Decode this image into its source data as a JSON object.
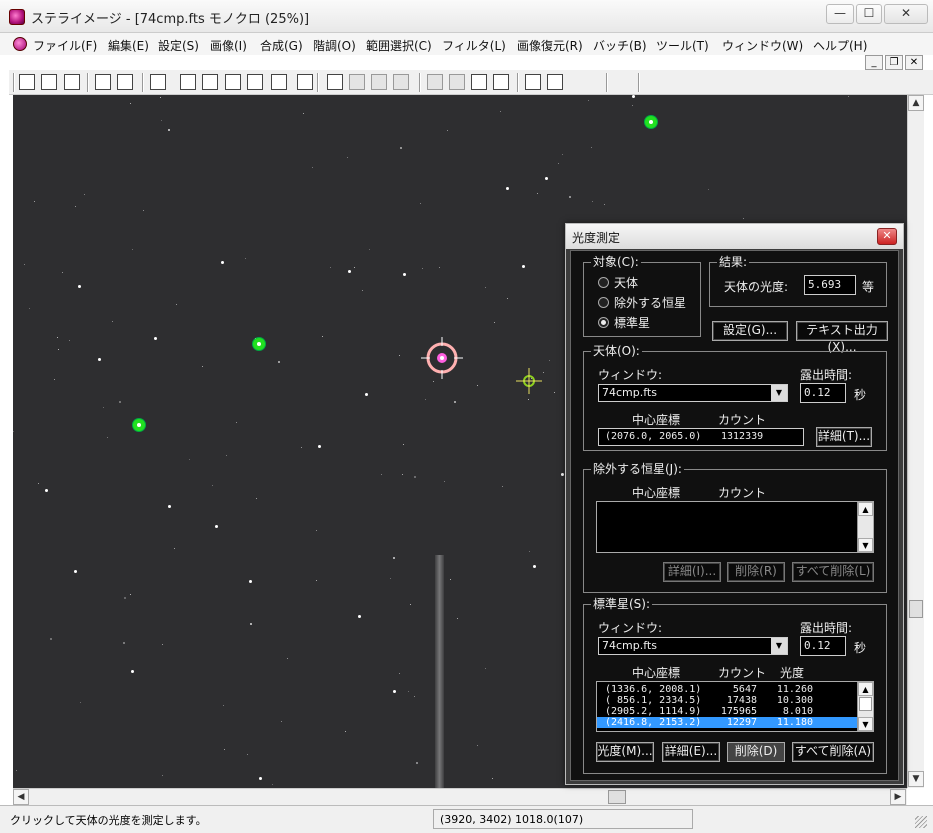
{
  "window": {
    "title": "ステライメージ - [74cmp.fts モノクロ (25%)]",
    "minimize": "—",
    "maximize": "☐",
    "close": "✕"
  },
  "menu": [
    "ファイル(F)",
    "編集(E)",
    "設定(S)",
    "画像(I)",
    "合成(G)",
    "階調(O)",
    "範囲選択(C)",
    "フィルタ(L)",
    "画像復元(R)",
    "バッチ(B)",
    "ツール(T)",
    "ウィンドウ(W)",
    "ヘルプ(H)"
  ],
  "mdi": {
    "minimize": "_",
    "restore": "❐",
    "close": "✕"
  },
  "toolbar_icons": [
    "open-icon",
    "save-icon",
    "print-icon",
    "copy-icon",
    "paste-icon",
    "info-icon",
    "level-icon",
    "histogram-icon",
    "curve-icon",
    "stack-icon",
    "align-icon",
    "grid-icon",
    "ruler-icon",
    "star-icon",
    "photometry-icon",
    "filter-icon",
    "sharpen-icon",
    "mask-icon",
    "zoom-icon",
    "measure-icon",
    "crosshair-icon",
    "target-icon"
  ],
  "status": {
    "message": "クリックして天体の光度を測定します。",
    "coords": "(3920, 3402) 1018.0(107)"
  },
  "dialog": {
    "title": "光度測定",
    "target": {
      "label": "対象(C):",
      "options": [
        "天体",
        "除外する恒星",
        "標準星"
      ],
      "selected": "標準星"
    },
    "result": {
      "label": "結果:",
      "magnitude_label": "天体の光度:",
      "magnitude_value": "5.693",
      "unit": "等",
      "settings_button": "設定(G)...",
      "text_output_button": "テキスト出力(X)..."
    },
    "object": {
      "label": "天体(O):",
      "window_label": "ウィンドウ:",
      "window_value": "74cmp.fts",
      "exposure_label": "露出時間:",
      "exposure_value": "0.12",
      "exposure_unit": "秒",
      "center_header": "中心座標",
      "count_header": "カウント",
      "center_value": "(2076.0, 2065.0)",
      "count_value": "1312339",
      "detail_button": "詳細(T)..."
    },
    "excluded": {
      "label": "除外する恒星(J):",
      "center_header": "中心座標",
      "count_header": "カウント",
      "detail_button": "詳細(I)...",
      "delete_button": "削除(R)",
      "delete_all_button": "すべて削除(L)"
    },
    "standard": {
      "label": "標準星(S):",
      "window_label": "ウィンドウ:",
      "window_value": "74cmp.fts",
      "exposure_label": "露出時間:",
      "exposure_value": "0.12",
      "exposure_unit": "秒",
      "center_header": "中心座標",
      "count_header": "カウント",
      "mag_header": "光度",
      "rows": [
        {
          "center": "(1336.6, 2008.1)",
          "count": "5647",
          "mag": "11.260"
        },
        {
          "center": "( 856.1, 2334.5)",
          "count": "17438",
          "mag": "10.300"
        },
        {
          "center": "(2905.2, 1114.9)",
          "count": "175965",
          "mag": "8.010"
        },
        {
          "center": "(2416.8, 2153.2)",
          "count": "12297",
          "mag": "11.180"
        }
      ],
      "selected_row": 3,
      "mag_button": "光度(M)...",
      "detail_button": "詳細(E)...",
      "delete_button": "削除(D)",
      "delete_all_button": "すべて削除(A)"
    }
  }
}
